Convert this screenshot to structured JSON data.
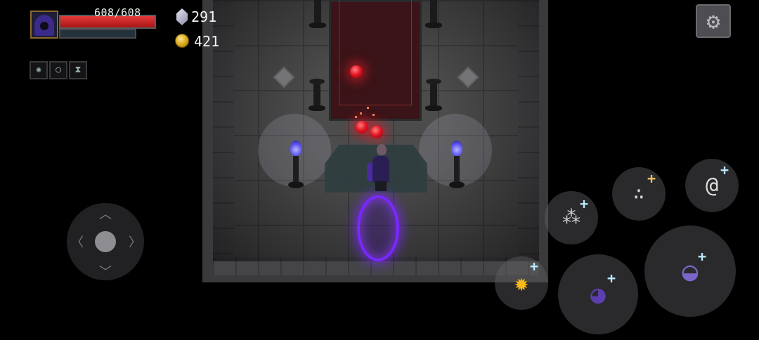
{
  "hud": {
    "hp_text": "608/608",
    "hp_current": 608,
    "hp_max": 608,
    "mana_fraction": 1.0,
    "crystals": "291",
    "gold": "421"
  },
  "buffs": [
    {
      "icon": "spiked-orb-icon"
    },
    {
      "icon": "dark-ring-icon"
    },
    {
      "icon": "hourglass-icon"
    }
  ],
  "settings": {
    "icon": "gear-icon"
  },
  "joystick": {
    "icon": "dpad-joystick-icon"
  },
  "skills": [
    {
      "name": "fire-burst",
      "icon": "fire-burst-icon",
      "color": "#f8b818"
    },
    {
      "name": "hooded-dash",
      "icon": "hooded-mage-dash-icon",
      "color": "#5b3fb0"
    },
    {
      "name": "hooded-basic",
      "icon": "hooded-mage-icon",
      "color": "#7a66c8"
    },
    {
      "name": "spirit-summon",
      "icon": "spirit-summon-icon",
      "color": "#d0d0d0"
    },
    {
      "name": "triple-orb",
      "icon": "triple-orb-icon",
      "color": "#d8d8d8"
    },
    {
      "name": "spiral-slash",
      "icon": "spiral-slash-icon",
      "color": "#e0e0e0"
    }
  ],
  "colors": {
    "hp": "#d42828",
    "portal": "#7a28ff",
    "brazier_flame": "#5a50f0",
    "red_orb": "#e01020",
    "carpet": "#3a1418"
  }
}
